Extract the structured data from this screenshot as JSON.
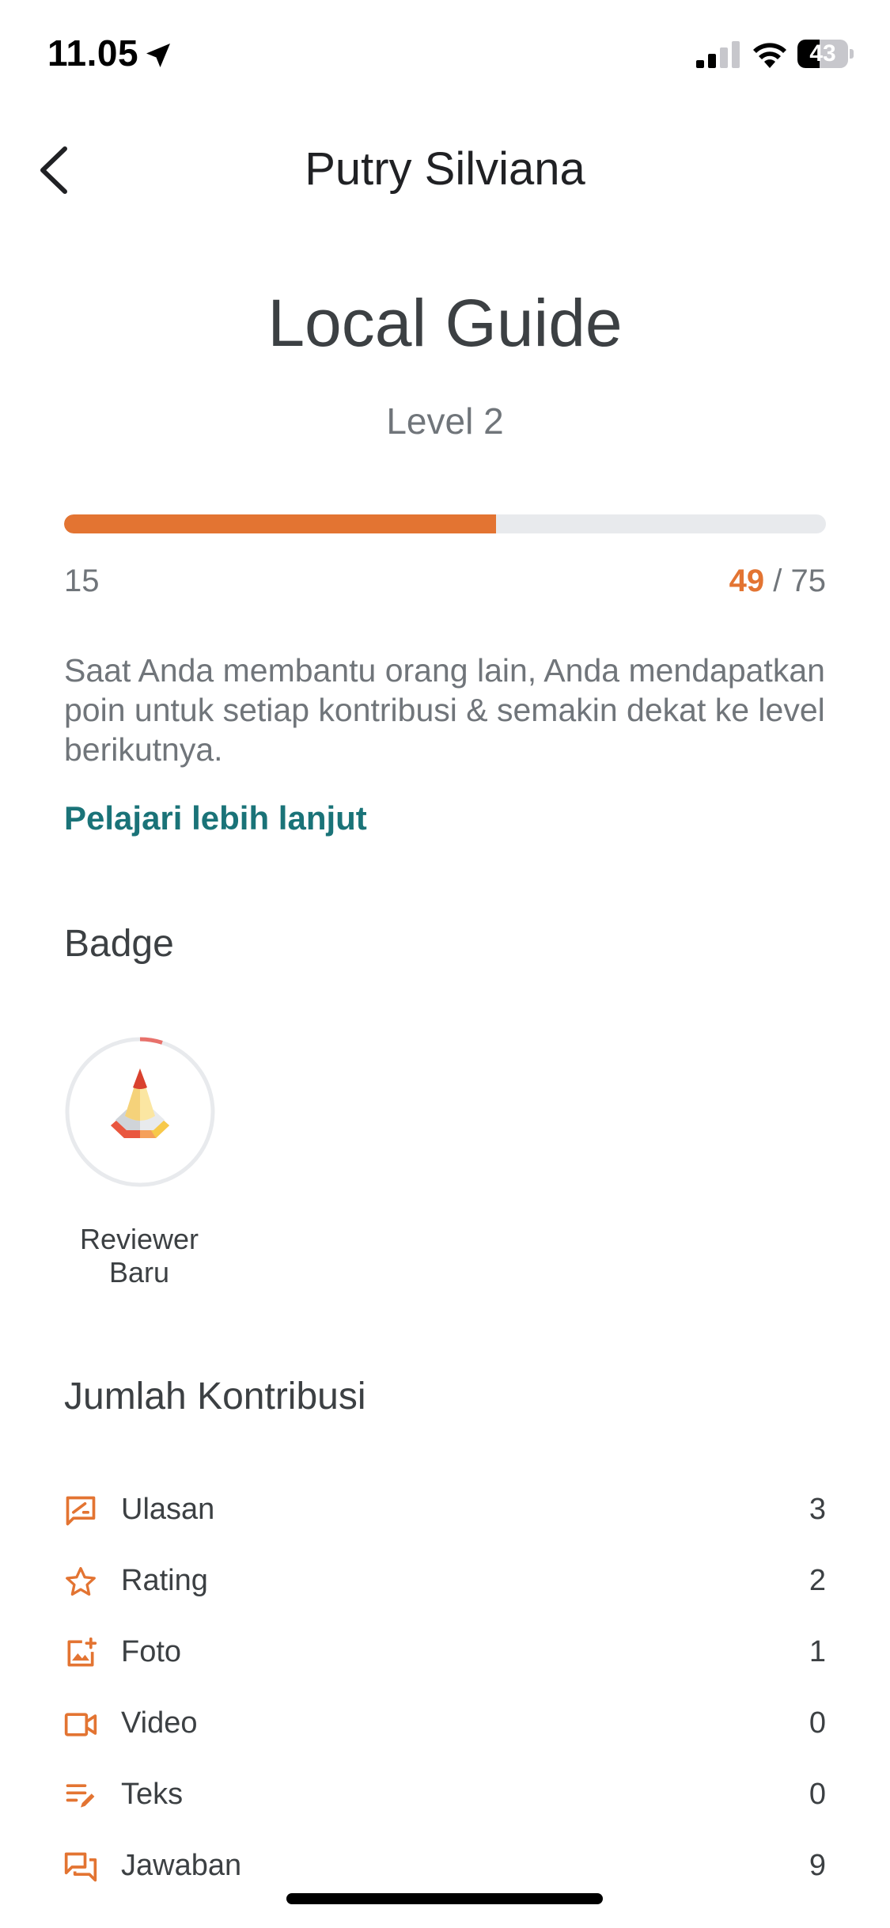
{
  "status_bar": {
    "time": "11.05",
    "battery_level": "43",
    "battery_fraction": 0.43,
    "icons": [
      "location-arrow-icon",
      "cellular-signal-icon",
      "wifi-icon",
      "battery-icon"
    ]
  },
  "header": {
    "title": "Putry Silviana",
    "back_icon": "chevron-left-icon"
  },
  "hero": {
    "title": "Local Guide",
    "level": "Level 2"
  },
  "progress": {
    "min": "15",
    "current": "49",
    "separator": " / ",
    "max": "75",
    "fraction": 0.5667,
    "accent_color": "#e37432",
    "track_color": "#e8eaed"
  },
  "description": "Saat Anda membantu orang lain, Anda mendapatkan poin untuk setiap kontribusi & semakin dekat ke level berikutnya.",
  "learn_more": {
    "label": "Pelajari lebih lanjut",
    "color": "#1a7378"
  },
  "badges": {
    "heading": "Badge",
    "items": [
      {
        "label": "Reviewer Baru",
        "icon": "reviewer-badge-icon",
        "progress_fraction": 0.05
      }
    ]
  },
  "contributions": {
    "heading": "Jumlah Kontribusi",
    "icon_color": "#e37432",
    "items": [
      {
        "label": "Ulasan",
        "value": "3",
        "icon": "review-icon"
      },
      {
        "label": "Rating",
        "value": "2",
        "icon": "star-icon"
      },
      {
        "label": "Foto",
        "value": "1",
        "icon": "add-photo-icon"
      },
      {
        "label": "Video",
        "value": "0",
        "icon": "video-icon"
      },
      {
        "label": "Teks",
        "value": "0",
        "icon": "edit-text-icon"
      },
      {
        "label": "Jawaban",
        "value": "9",
        "icon": "answer-icon"
      }
    ]
  }
}
